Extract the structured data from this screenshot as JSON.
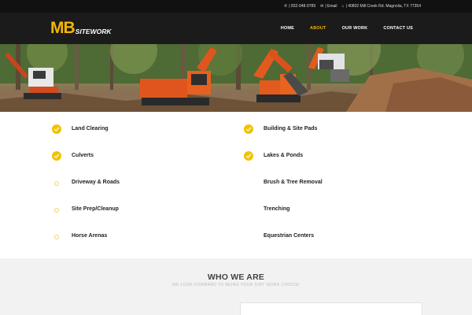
{
  "topbar": {
    "phone": "| 832-948-9789",
    "email": "| Email",
    "address": "| 40802 Mill Creek Rd. Magnolia, TX 77354",
    "phone_icon": "phone-icon",
    "email_icon": "envelope-icon",
    "address_icon": "home-icon"
  },
  "logo": {
    "mb": "MB",
    "site": "SITEWORK"
  },
  "nav": [
    {
      "label": "HOME",
      "active": false
    },
    {
      "label": "ABOUT",
      "active": true
    },
    {
      "label": "OUR WORK",
      "active": false
    },
    {
      "label": "CONTACT US",
      "active": false
    }
  ],
  "services": {
    "left": [
      {
        "label": "Land Clearing",
        "icon": "check-circle-icon"
      },
      {
        "label": "Culverts",
        "icon": "check-circle-icon"
      },
      {
        "label": "Driveway & Roads",
        "icon": "faded-circle-icon"
      },
      {
        "label": "Site Prep/Cleanup",
        "icon": "faded-circle-icon"
      },
      {
        "label": "Horse Arenas",
        "icon": "faded-circle-icon"
      }
    ],
    "right": [
      {
        "label": "Building & Site Pads",
        "icon": "check-circle-icon"
      },
      {
        "label": "Lakes & Ponds",
        "icon": "check-circle-icon"
      },
      {
        "label": "Brush & Tree Removal",
        "icon": ""
      },
      {
        "label": "Trenching",
        "icon": ""
      },
      {
        "label": "Equestrian Centers",
        "icon": ""
      }
    ]
  },
  "who": {
    "title": "WHO WE ARE",
    "subtitle": "WE LOOK FORWARD TO BEING YOUR DIRT WORK CHOICE!"
  },
  "colors": {
    "accent": "#f2b705",
    "header_bg": "#1b1b1b",
    "topbar_bg": "#111111",
    "section_bg": "#f2f2f2"
  }
}
